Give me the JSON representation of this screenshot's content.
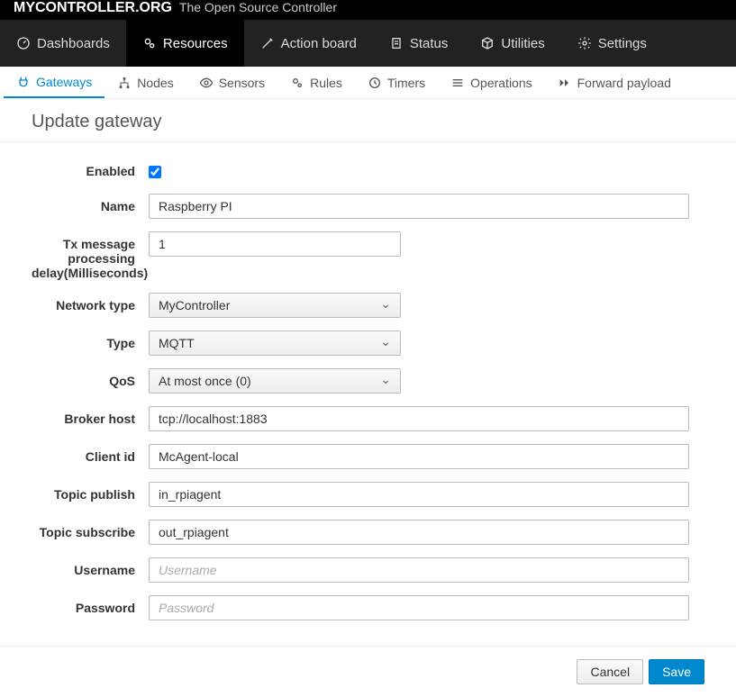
{
  "header": {
    "brand": "MYCONTROLLER.ORG",
    "tagline": "The Open Source Controller"
  },
  "nav_primary": [
    {
      "label": "Dashboards",
      "icon": "dashboard"
    },
    {
      "label": "Resources",
      "icon": "gears",
      "active": true
    },
    {
      "label": "Action board",
      "icon": "wand"
    },
    {
      "label": "Status",
      "icon": "file"
    },
    {
      "label": "Utilities",
      "icon": "cube"
    },
    {
      "label": "Settings",
      "icon": "gear"
    }
  ],
  "nav_secondary": [
    {
      "label": "Gateways",
      "icon": "plug",
      "active": true
    },
    {
      "label": "Nodes",
      "icon": "sitemap"
    },
    {
      "label": "Sensors",
      "icon": "eye"
    },
    {
      "label": "Rules",
      "icon": "gears-sm"
    },
    {
      "label": "Timers",
      "icon": "clock"
    },
    {
      "label": "Operations",
      "icon": "list"
    },
    {
      "label": "Forward payload",
      "icon": "forward"
    }
  ],
  "page_title": "Update gateway",
  "form": {
    "enabled": {
      "label": "Enabled",
      "checked": true
    },
    "name": {
      "label": "Name",
      "value": "Raspberry PI"
    },
    "tx_delay": {
      "label": "Tx message processing delay(Milliseconds)",
      "value": "1"
    },
    "network_type": {
      "label": "Network type",
      "value": "MyController"
    },
    "type": {
      "label": "Type",
      "value": "MQTT"
    },
    "qos": {
      "label": "QoS",
      "value": "At most once (0)"
    },
    "broker_host": {
      "label": "Broker host",
      "value": "tcp://localhost:1883"
    },
    "client_id": {
      "label": "Client id",
      "value": "McAgent-local"
    },
    "topic_publish": {
      "label": "Topic publish",
      "value": "in_rpiagent"
    },
    "topic_subscribe": {
      "label": "Topic subscribe",
      "value": "out_rpiagent"
    },
    "username": {
      "label": "Username",
      "value": "",
      "placeholder": "Username"
    },
    "password": {
      "label": "Password",
      "value": "",
      "placeholder": "Password"
    }
  },
  "buttons": {
    "cancel": "Cancel",
    "save": "Save"
  }
}
